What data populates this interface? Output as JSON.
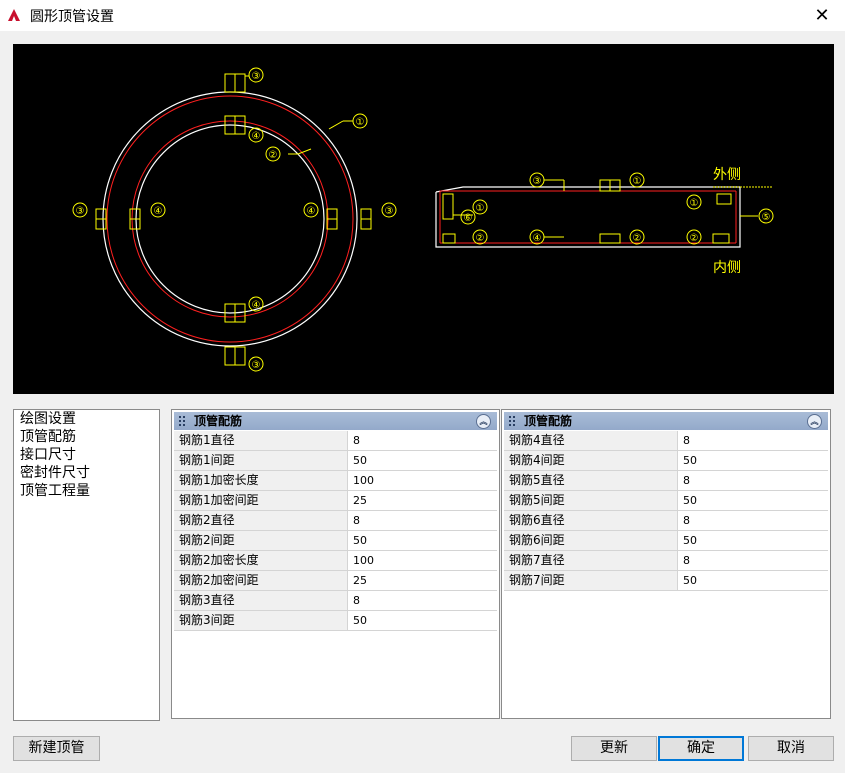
{
  "window": {
    "title": "圆形顶管设置",
    "close_label": "✕"
  },
  "drawing": {
    "labels": {
      "outer": "外侧",
      "inner": "内侧"
    },
    "markers": [
      "①",
      "②",
      "③",
      "④",
      "⑤",
      "⑥"
    ]
  },
  "nav": {
    "items": [
      "绘图设置",
      "顶管配筋",
      "接口尺寸",
      "密封件尺寸",
      "顶管工程量"
    ]
  },
  "grid_left": {
    "title": "顶管配筋",
    "rows": [
      {
        "key": "钢筋1直径",
        "value": "8"
      },
      {
        "key": "钢筋1间距",
        "value": "50"
      },
      {
        "key": "钢筋1加密长度",
        "value": "100"
      },
      {
        "key": "钢筋1加密间距",
        "value": "25"
      },
      {
        "key": "钢筋2直径",
        "value": "8"
      },
      {
        "key": "钢筋2间距",
        "value": "50"
      },
      {
        "key": "钢筋2加密长度",
        "value": "100"
      },
      {
        "key": "钢筋2加密间距",
        "value": "25"
      },
      {
        "key": "钢筋3直径",
        "value": "8"
      },
      {
        "key": "钢筋3间距",
        "value": "50"
      }
    ]
  },
  "grid_right": {
    "title": "顶管配筋",
    "rows": [
      {
        "key": "钢筋4直径",
        "value": "8"
      },
      {
        "key": "钢筋4间距",
        "value": "50"
      },
      {
        "key": "钢筋5直径",
        "value": "8"
      },
      {
        "key": "钢筋5间距",
        "value": "50"
      },
      {
        "key": "钢筋6直径",
        "value": "8"
      },
      {
        "key": "钢筋6间距",
        "value": "50"
      },
      {
        "key": "钢筋7直径",
        "value": "8"
      },
      {
        "key": "钢筋7间距",
        "value": "50"
      }
    ]
  },
  "buttons": {
    "new_pipe": "新建顶管",
    "update": "更新",
    "ok": "确定",
    "cancel": "取消"
  },
  "colors": {
    "drawing_bg": "#000000",
    "rebar": "#ff2020",
    "concrete": "#ffffff",
    "annotation": "#ffff00",
    "accent": "#0078d7"
  }
}
